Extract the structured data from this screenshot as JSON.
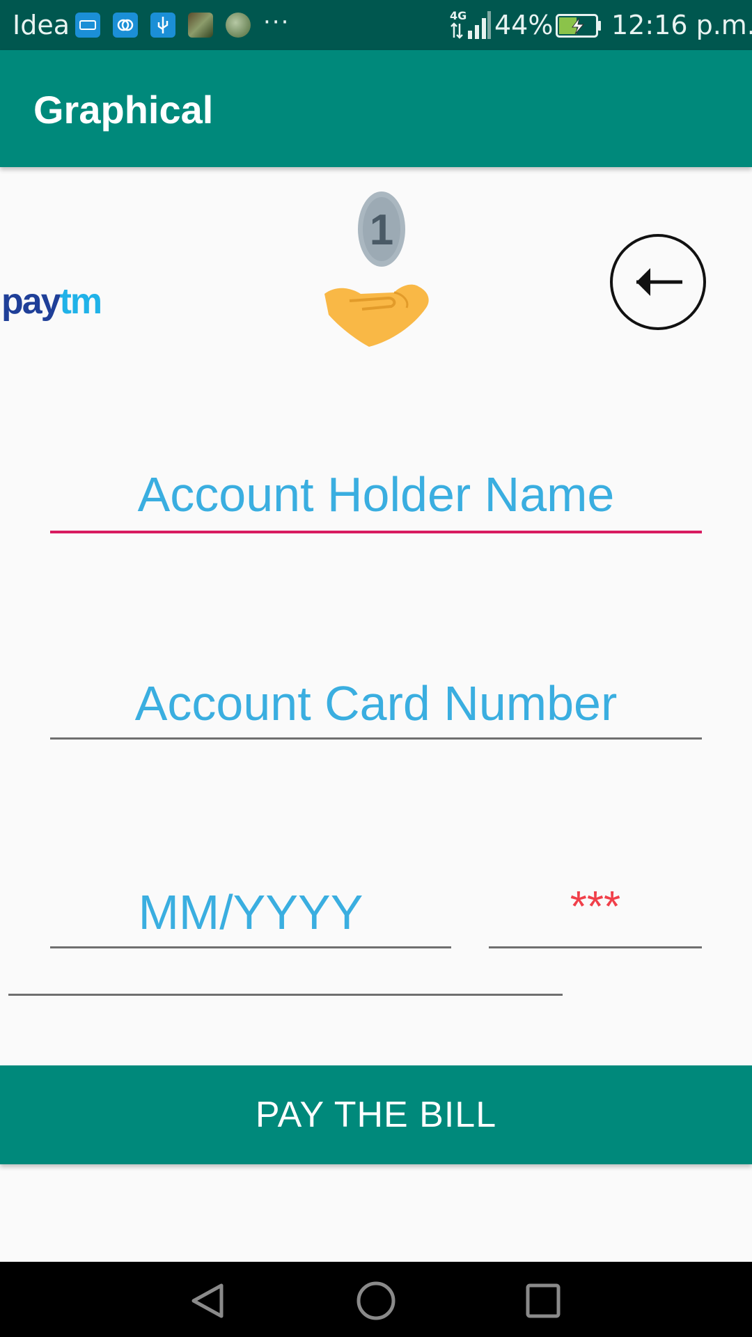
{
  "status_bar": {
    "carrier": "Idea",
    "more": "···",
    "battery_percent": "44%",
    "time": "12:16 p.m.",
    "icons": [
      "app-notification-icon",
      "link-app-icon",
      "usb-icon",
      "photo-thumbnail-icon",
      "globe-thumbnail-icon",
      "signal-4g-icon",
      "battery-charging-icon"
    ]
  },
  "app_bar": {
    "title": "Graphical"
  },
  "header": {
    "logo_text": "paytm",
    "coin_label": "1",
    "icons": [
      "paytm-logo",
      "coin-in-hand-icon",
      "back-arrow-icon"
    ]
  },
  "form": {
    "holder_name_placeholder": "Account Holder Name",
    "card_number_placeholder": "Account Card Number",
    "expiry_placeholder": "MM/YYYY",
    "cvv_placeholder": "***",
    "extra_value": ""
  },
  "pay_button": {
    "label": "PAY THE BILL"
  },
  "nav_bar": {
    "icons": [
      "nav-back-icon",
      "nav-home-icon",
      "nav-recents-icon"
    ]
  },
  "colors": {
    "status_bar": "#00574f",
    "primary": "#00897b",
    "hint_text": "#3aaee0",
    "focused_underline": "#d81b60",
    "cvv_hint": "#f0404a",
    "coin": "#aab7c0",
    "hand": "#f9b846",
    "paytm_blue": "#1f3f98",
    "paytm_light_blue": "#20b2e8"
  }
}
